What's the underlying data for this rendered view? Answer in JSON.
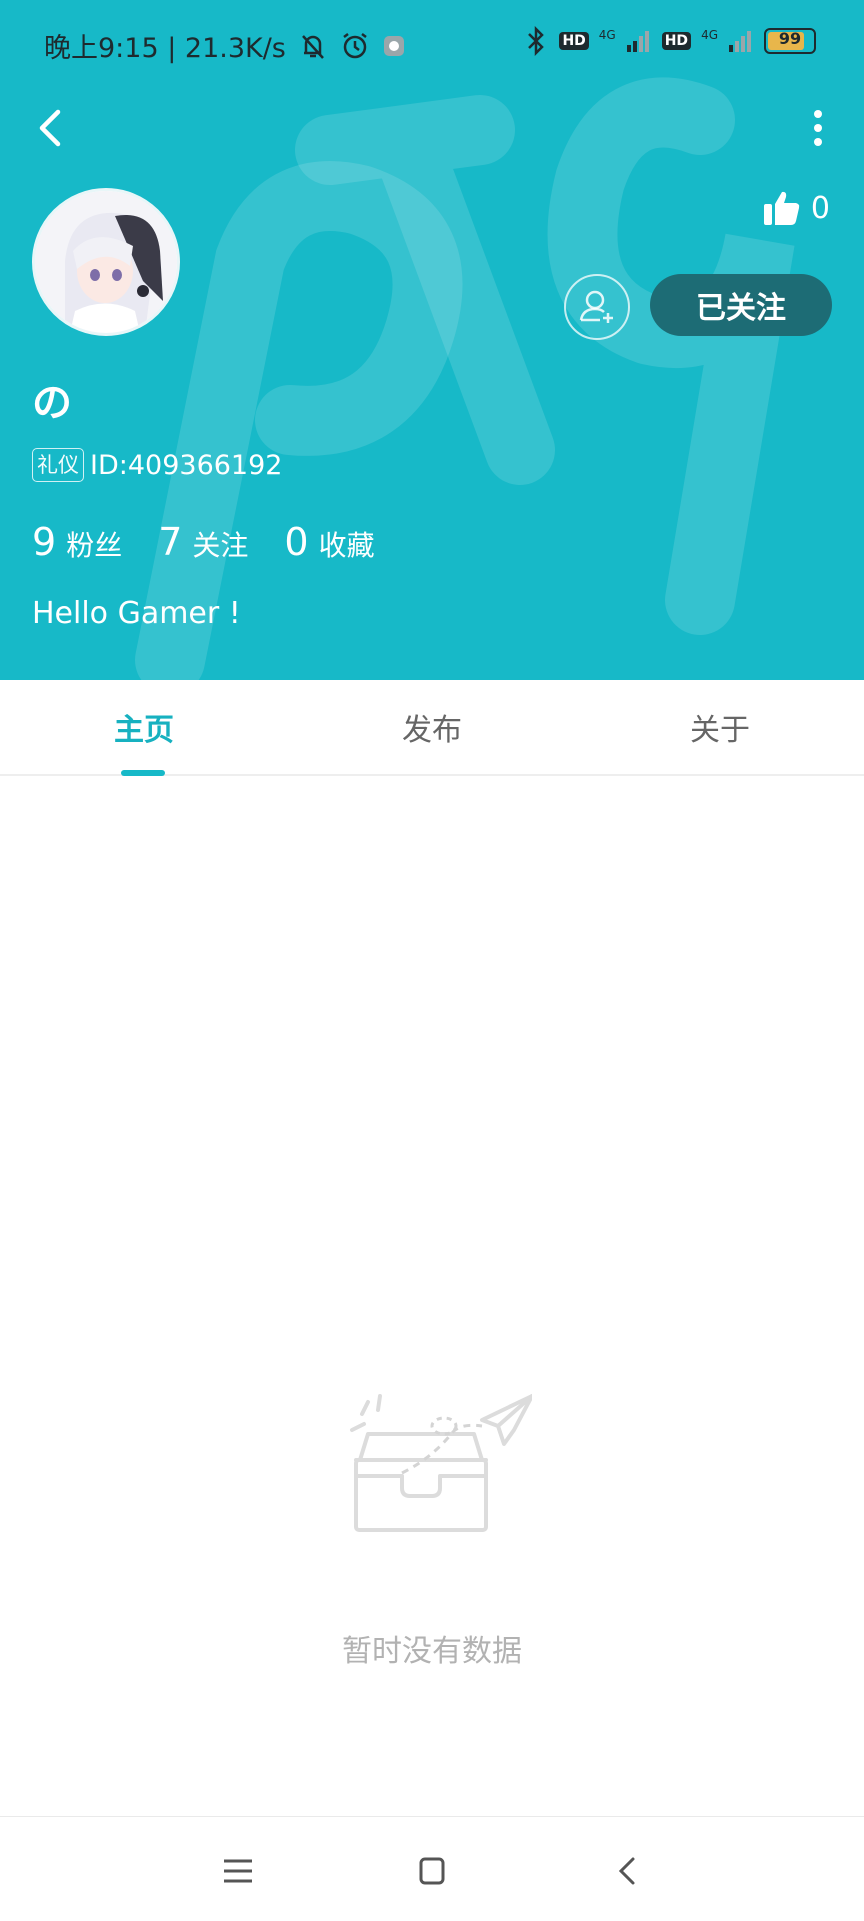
{
  "status_bar": {
    "time_speed": "晚上9:15 | 21.3K/s",
    "hd1": "HD",
    "net1": "4G",
    "hd2": "HD",
    "net2": "4G",
    "battery": "99"
  },
  "profile": {
    "like_count": "0",
    "follow_button": "已关注",
    "username": "の",
    "badge": "礼仪",
    "user_id": "ID:409366192",
    "stats": [
      {
        "value": "9",
        "label": "粉丝"
      },
      {
        "value": "7",
        "label": "关注"
      },
      {
        "value": "0",
        "label": "收藏"
      }
    ],
    "bio": "Hello Gamer !"
  },
  "tabs": [
    {
      "label": "主页",
      "active": true
    },
    {
      "label": "发布",
      "active": false
    },
    {
      "label": "关于",
      "active": false
    }
  ],
  "empty_state": {
    "text": "暂时没有数据"
  },
  "colors": {
    "header_bg": "#17b9c8",
    "follow_btn_bg": "#1d6c75",
    "tab_active": "#17b1c0"
  }
}
